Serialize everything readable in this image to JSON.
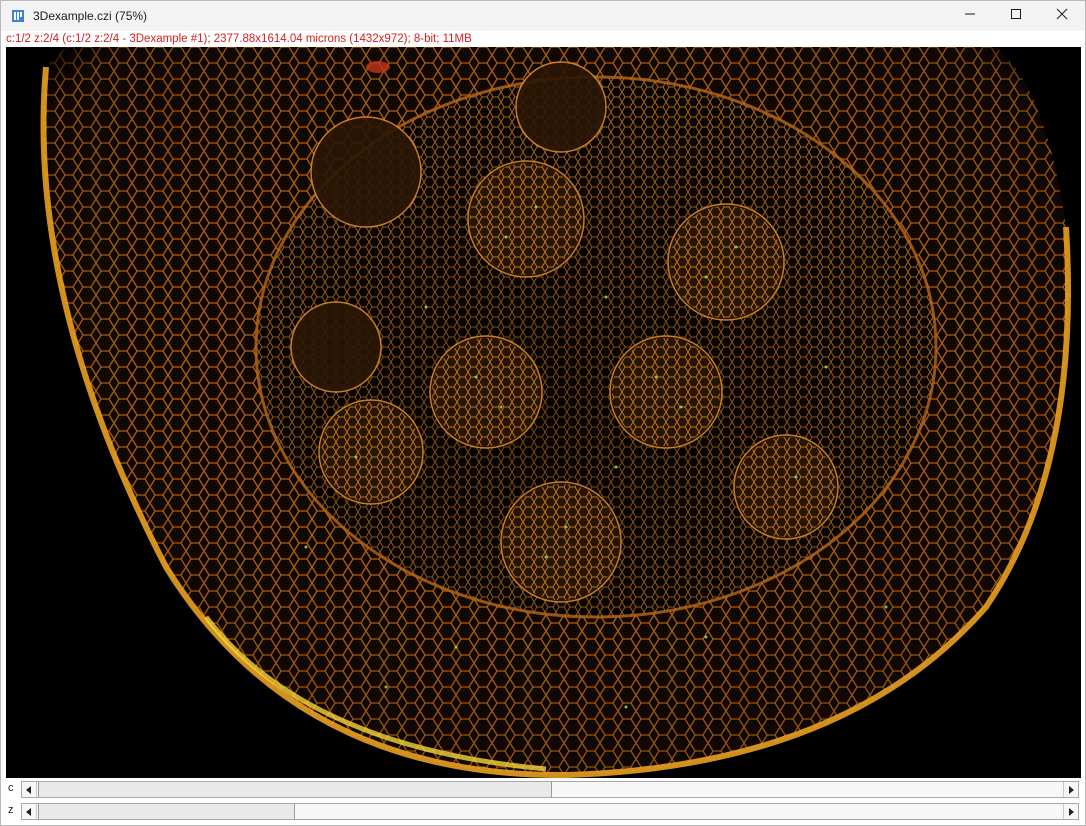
{
  "window": {
    "title": "3Dexample.czi (75%)",
    "icons": {
      "app": "imagej-window-icon",
      "minimize": "minimize-icon",
      "maximize": "maximize-icon",
      "close": "close-icon"
    }
  },
  "info_line": "c:1/2 z:2/4 (c:1/2 z:2/4 - 3Dexample #1); 2377.88x1614.04 microns (1432x972); 8-bit; 11MB",
  "sliders": {
    "c": {
      "label": "c",
      "position": 1,
      "total": 2
    },
    "z": {
      "label": "z",
      "position": 2,
      "total": 4
    }
  },
  "colors": {
    "info_text": "#d12020",
    "image_background": "#000000",
    "cell_wall_orange": "#e08a1e",
    "cell_wall_yellow": "#f2d23a"
  }
}
